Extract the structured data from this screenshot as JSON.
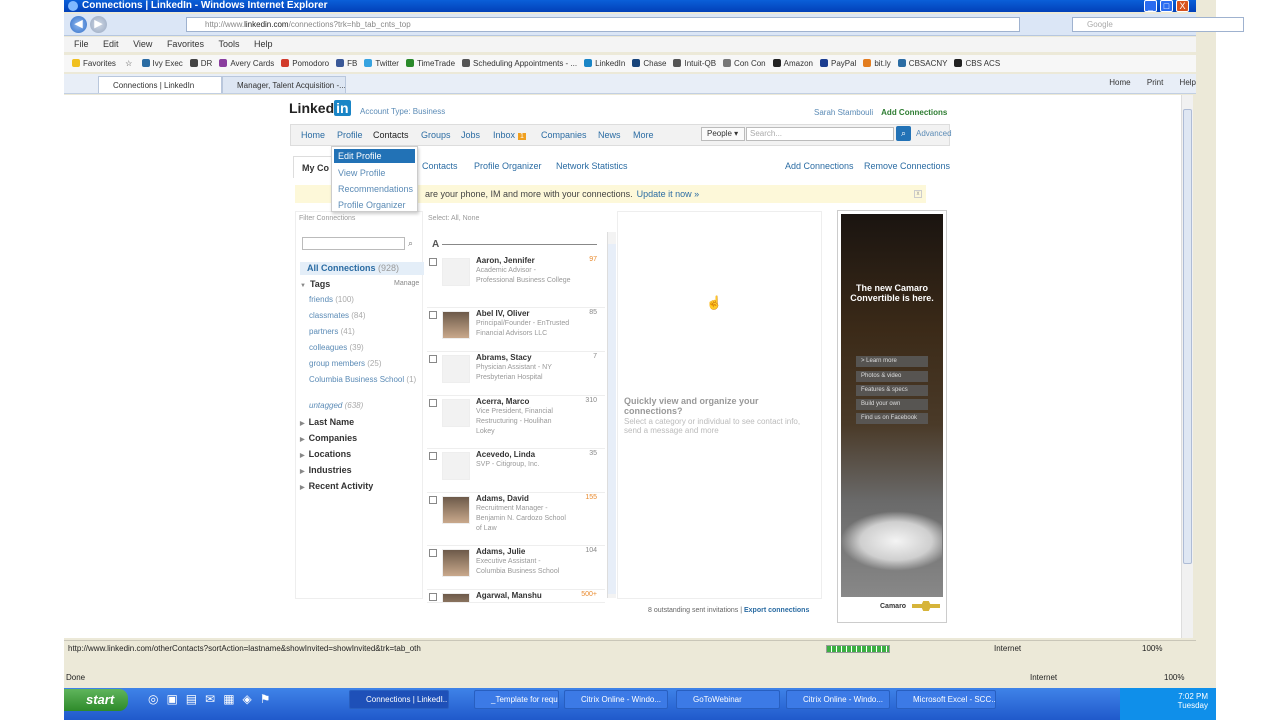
{
  "window": {
    "title": "Connections | LinkedIn - Windows Internet Explorer",
    "address_prefix": "http://www.",
    "address_domain": "linkedin.com",
    "address_rest": "/connections?trk=hb_tab_cnts_top",
    "search_placeholder": "Google",
    "min_glyph": "_",
    "max_glyph": "□",
    "close_glyph": "X"
  },
  "menu": [
    "File",
    "Edit",
    "View",
    "Favorites",
    "Tools",
    "Help"
  ],
  "favorites": {
    "label": "Favorites",
    "items": [
      {
        "label": "Ivy Exec",
        "color": "#2b6ca3"
      },
      {
        "label": "DR",
        "color": "#444"
      },
      {
        "label": "Avery Cards",
        "color": "#8a3d9e"
      },
      {
        "label": "Pomodoro",
        "color": "#d23b2b"
      },
      {
        "label": "FB",
        "color": "#3b5998"
      },
      {
        "label": "Twitter",
        "color": "#37a3e0"
      },
      {
        "label": "TimeTrade",
        "color": "#2b8a2b"
      },
      {
        "label": "Scheduling Appointments - ...",
        "color": "#555"
      },
      {
        "label": "LinkedIn",
        "color": "#1a85c6"
      },
      {
        "label": "Chase",
        "color": "#17447a"
      },
      {
        "label": "Intuit-QB",
        "color": "#555"
      },
      {
        "label": "Con Con",
        "color": "#777"
      },
      {
        "label": "Amazon",
        "color": "#222"
      },
      {
        "label": "PayPal",
        "color": "#1b3d8f"
      },
      {
        "label": "bit.ly",
        "color": "#e37d1f"
      },
      {
        "label": "CBSACNY",
        "color": "#2b6ca3"
      },
      {
        "label": "CBS ACS",
        "color": "#222"
      }
    ]
  },
  "tabs": [
    {
      "label": "Connections | LinkedIn"
    },
    {
      "label": "Manager, Talent Acquisition -..."
    }
  ],
  "commands": [
    "Home",
    "Print",
    "Help"
  ],
  "linkedin": {
    "logo_text": "Linked",
    "logo_in": "in",
    "account_type": "Account Type: Business",
    "user": "Sarah Stambouli",
    "add_connections_top": "Add Connections",
    "nav": [
      "Home",
      "Profile",
      "Contacts",
      "Groups",
      "Jobs",
      "Inbox",
      "Companies",
      "News",
      "More"
    ],
    "inbox_badge": "1",
    "search_scope": "People",
    "search_placeholder": "Search...",
    "advanced": "Advanced",
    "profile_menu": [
      "Edit Profile",
      "View Profile",
      "Recommendations",
      "Profile Organizer"
    ],
    "subtab_active": "My Co",
    "subnav": [
      "Contacts",
      "Profile Organizer",
      "Network Statistics"
    ],
    "subnav_right": [
      "Add Connections",
      "Remove Connections"
    ],
    "notice_text": "are your phone, IM and more with your connections.",
    "notice_link": "Update it now »",
    "filter_label": "Filter Connections",
    "select_label": "Select: All, None",
    "all_connections": "All Connections",
    "all_count": "(928)",
    "tags_head": "Tags",
    "manage": "Manage",
    "tags": [
      {
        "label": "friends",
        "count": "(100)"
      },
      {
        "label": "classmates",
        "count": "(84)"
      },
      {
        "label": "partners",
        "count": "(41)"
      },
      {
        "label": "colleagues",
        "count": "(39)"
      },
      {
        "label": "group members",
        "count": "(25)"
      },
      {
        "label": "Columbia Business School",
        "count": "(1)"
      },
      {
        "label": "untagged",
        "count": "(638)"
      }
    ],
    "sections": [
      "Last Name",
      "Companies",
      "Locations",
      "Industries",
      "Recent Activity"
    ],
    "alpha": "A",
    "connections": [
      {
        "name": "Aaron, Jennifer",
        "desc": "Academic Advisor - Professional Business College",
        "count": "97",
        "photo": false,
        "orange": true
      },
      {
        "name": "Abel IV, Oliver",
        "desc": "Principal/Founder - EnTrusted Financial Advisors LLC",
        "count": "85",
        "photo": true,
        "orange": false
      },
      {
        "name": "Abrams, Stacy",
        "desc": "Physician Assistant - NY Presbyterian Hospital",
        "count": "7",
        "photo": false,
        "orange": false
      },
      {
        "name": "Acerra, Marco",
        "desc": "Vice President, Financial Restructuring - Houlihan Lokey",
        "count": "310",
        "photo": false,
        "orange": false
      },
      {
        "name": "Acevedo, Linda",
        "desc": "SVP - Citigroup, Inc.",
        "count": "35",
        "photo": false,
        "orange": false
      },
      {
        "name": "Adams, David",
        "desc": "Recruitment Manager - Benjamin N. Cardozo School of Law",
        "count": "155",
        "photo": true,
        "orange": true
      },
      {
        "name": "Adams, Julie",
        "desc": "Executive Assistant - Columbia Business School",
        "count": "104",
        "photo": true,
        "orange": false
      },
      {
        "name": "Agarwal, Manshu",
        "desc": "",
        "count": "500+",
        "photo": true,
        "orange": true
      }
    ],
    "quick_title": "Quickly view and organize your connections?",
    "quick_text": "Select a category or individual to see contact info, send a message and more",
    "outstanding": "8 outstanding sent invitations |",
    "export": "Export connections",
    "ad": {
      "headline": "The new Camaro Convertible is here.",
      "buttons": [
        "> Learn more",
        "Photos & video",
        "Features & specs",
        "Build your own",
        "Find us on Facebook"
      ],
      "brand": "Camaro"
    }
  },
  "status": {
    "url": "http://www.linkedin.com/otherContacts?sortAction=lastname&showInvited=showInvited&trk=tab_oth",
    "zone": "Internet",
    "zoom": "100%",
    "done": "Done",
    "zone2": "Internet",
    "zoom2": "100%"
  },
  "taskbar": {
    "start": "start",
    "tasks": [
      "Connections | LinkedI...",
      "_Template for reques...",
      "Citrix Online - Windo...",
      "GoToWebinar",
      "Citrix Online - Windo...",
      "Microsoft Excel - SCC..."
    ],
    "time": "7:02 PM",
    "day": "Tuesday"
  }
}
